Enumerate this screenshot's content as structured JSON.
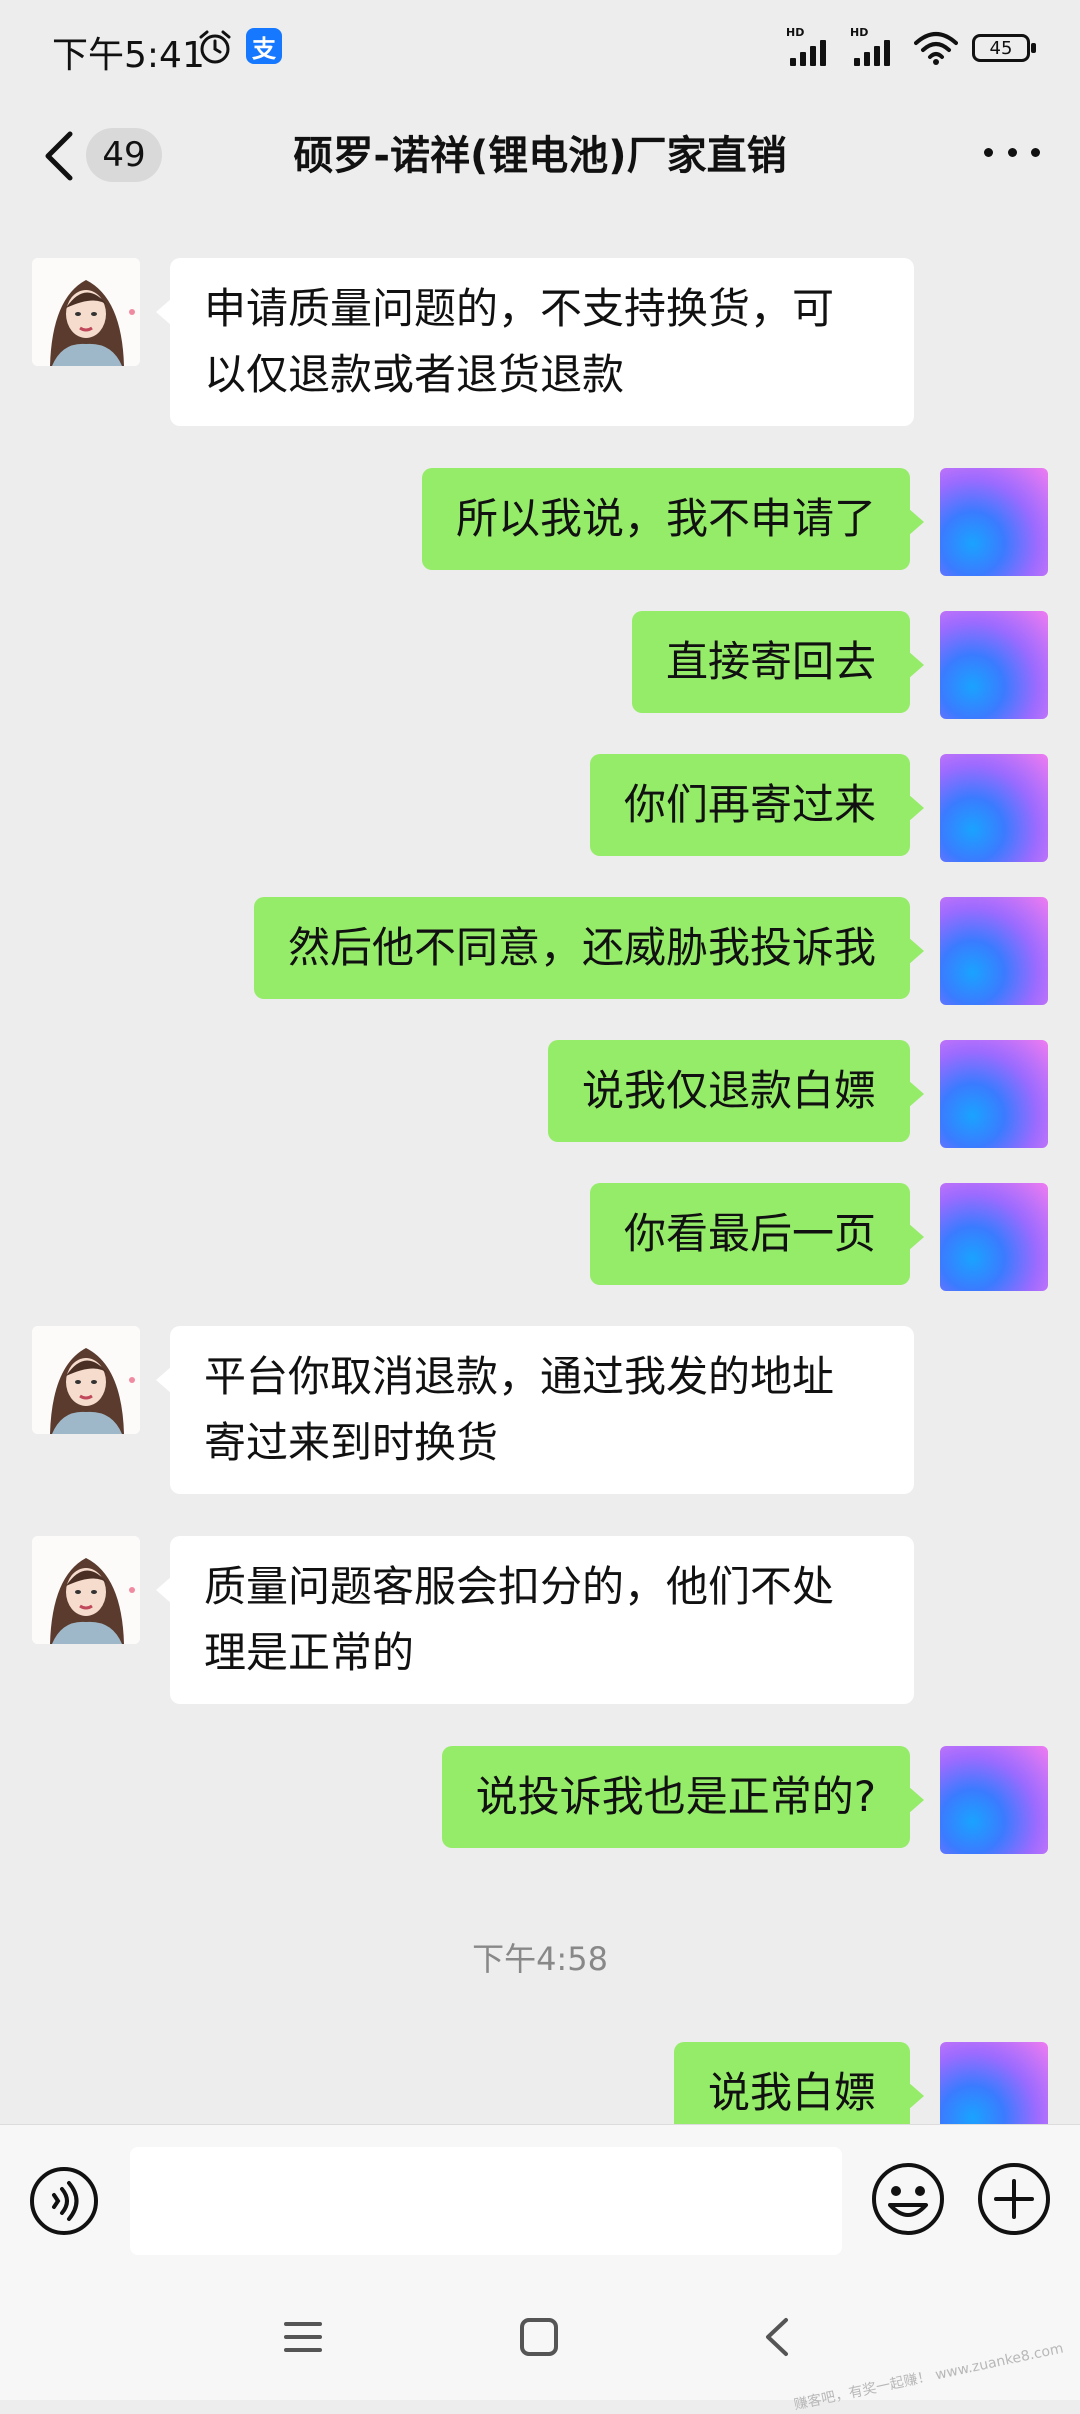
{
  "status_bar": {
    "time": "下午5:41",
    "alipay_icon_text": "支",
    "battery": "45",
    "sim1_label": "HD",
    "sim2_label": "HD"
  },
  "header": {
    "unread_count": "49",
    "title": "硕罗-诺祥(锂电池)厂家直销"
  },
  "messages": [
    {
      "side": "in",
      "lines": [
        "申请质量问题的，不支持换货，可",
        "以仅退款或者退货退款"
      ]
    },
    {
      "side": "out",
      "lines": [
        "所以我说，我不申请了"
      ]
    },
    {
      "side": "out",
      "lines": [
        "直接寄回去"
      ]
    },
    {
      "side": "out",
      "lines": [
        "你们再寄过来"
      ]
    },
    {
      "side": "out",
      "lines": [
        "然后他不同意，还威胁我投诉我"
      ]
    },
    {
      "side": "out",
      "lines": [
        "说我仅退款白嫖"
      ]
    },
    {
      "side": "out",
      "lines": [
        "你看最后一页"
      ]
    },
    {
      "side": "in",
      "lines": [
        "平台你取消退款，通过我发的地址",
        "寄过来到时换货"
      ]
    },
    {
      "side": "in",
      "lines": [
        "质量问题客服会扣分的，他们不处",
        "理是正常的"
      ]
    },
    {
      "side": "out",
      "lines": [
        "说投诉我也是正常的?"
      ]
    },
    {
      "side": "out",
      "lines": [
        "说我白嫖"
      ]
    }
  ],
  "timestamp": "下午4:58",
  "watermark": "赚客吧，有奖一起赚！ www.zuanke8.com",
  "colors": {
    "incoming_bubble": "#ffffff",
    "outgoing_bubble": "#95ec69",
    "background": "#ededed"
  }
}
